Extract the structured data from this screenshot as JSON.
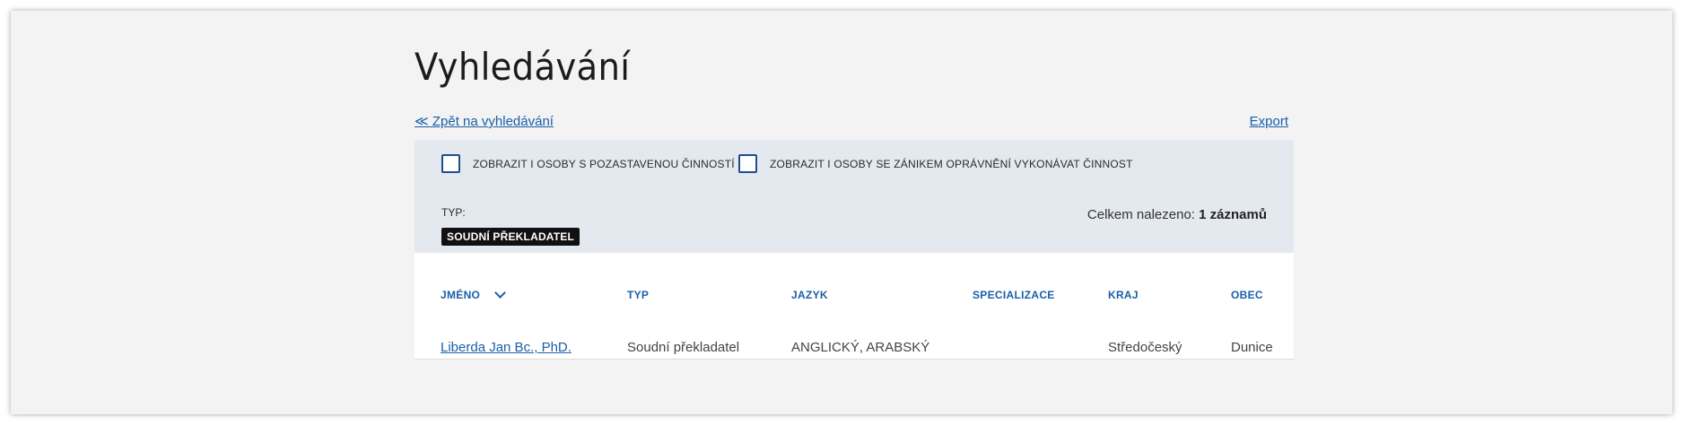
{
  "page_title": "Vyhledávání",
  "back_link": "≪ Zpět na vyhledávání",
  "export_link": "Export",
  "filters": {
    "checkbox_suspended": "ZOBRAZIT I OSOBY S POZASTAVENOU ČINNOSTÍ",
    "checkbox_terminated": "ZOBRAZIT I OSOBY SE ZÁNIKEM OPRÁVNĚNÍ VYKONÁVAT ČINNOST",
    "type_label": "TYP:",
    "type_badge": "SOUDNÍ PŘEKLADATEL",
    "total_prefix": "Celkem nalezeno:",
    "total_value": "1 záznamů"
  },
  "table": {
    "headers": {
      "name": "JMÉNO",
      "type": "TYP",
      "language": "JAZYK",
      "specialization": "SPECIALIZACE",
      "region": "KRAJ",
      "municipality": "OBEC"
    },
    "rows": [
      {
        "name": "Liberda Jan Bc., PhD.",
        "type": "Soudní překladatel",
        "language": "ANGLICKÝ, ARABSKÝ",
        "specialization": "",
        "region": "Středočeský",
        "municipality": "Dunice"
      }
    ]
  },
  "colors": {
    "link": "#1a5fa8",
    "panel": "#e4e9ef",
    "badge": "#111111"
  }
}
